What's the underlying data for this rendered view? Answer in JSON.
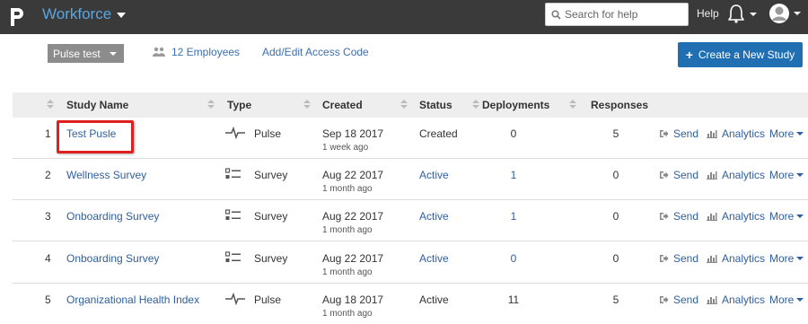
{
  "app": {
    "title": "Workforce",
    "search_placeholder": "Search for help",
    "help_label": "Help"
  },
  "toolbar": {
    "study_selector": "Pulse test",
    "employees_link": "12 Employees",
    "access_code_link": "Add/Edit Access Code",
    "create_button": "Create a New Study"
  },
  "table": {
    "headers": {
      "study_name": "Study Name",
      "type": "Type",
      "created": "Created",
      "status": "Status",
      "deployments": "Deployments",
      "responses": "Responses"
    },
    "rows": [
      {
        "num": "1",
        "name": "Test Pusle",
        "type": "Pulse",
        "type_icon": "pulse-icon",
        "created": "Sep 18 2017",
        "created_rel": "1 week ago",
        "status": "Created",
        "deployments": "0",
        "responses": "5"
      },
      {
        "num": "2",
        "name": "Wellness Survey",
        "type": "Survey",
        "type_icon": "survey-list-icon",
        "created": "Aug 22 2017",
        "created_rel": "1 month ago",
        "status": "Active",
        "deployments": "1",
        "responses": "0"
      },
      {
        "num": "3",
        "name": "Onboarding Survey",
        "type": "Survey",
        "type_icon": "survey-list-icon",
        "created": "Aug 22 2017",
        "created_rel": "1 month ago",
        "status": "Active",
        "deployments": "1",
        "responses": "0"
      },
      {
        "num": "4",
        "name": "Onboarding Survey",
        "type": "Survey",
        "type_icon": "survey-list-icon",
        "created": "Aug 22 2017",
        "created_rel": "1 month ago",
        "status": "Active",
        "deployments": "0",
        "responses": "0"
      },
      {
        "num": "5",
        "name": "Organizational Health Index",
        "type": "Pulse",
        "type_icon": "pulse-icon",
        "created": "Aug 18 2017",
        "created_rel": "1 month ago",
        "status": "Active",
        "deployments": "11",
        "responses": "5"
      }
    ],
    "actions": {
      "send": "Send",
      "analytics": "Analytics",
      "more": "More"
    }
  },
  "colors": {
    "topbar": "#3a3a3a",
    "brand": "#5ea5db",
    "link": "#2f5f9e",
    "primary_button": "#1f6fb2",
    "highlight": "#e02020"
  }
}
